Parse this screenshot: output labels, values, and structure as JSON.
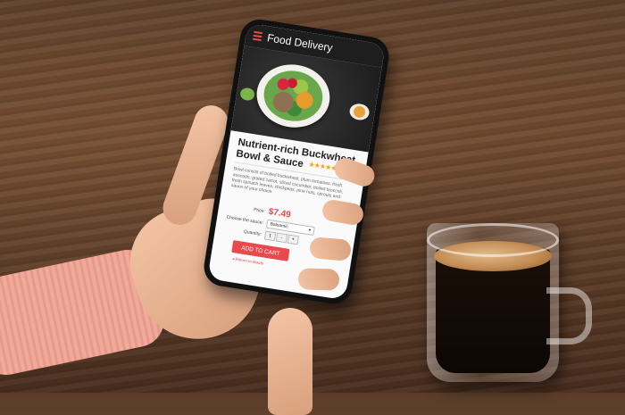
{
  "app": {
    "title": "Food Delivery"
  },
  "product": {
    "name": "Nutrient-rich Buckwheat Bowl & Sauce",
    "rating_stars": "★★★★★",
    "description": "Bowl consist of boiled buckwheat, plum tomatoes, fresh avocado, grated carrot, sliced cucumber, boiled broccoli, fresh spinach leaves, chickpeas, pine nuts, sprouts and sauce of your choice.",
    "price_label": "Price:",
    "price": "$7.49",
    "sauce_label": "Choose the sauce:",
    "sauce_selected": "Balsamic",
    "quantity_label": "Quantity:",
    "quantity_value": "1",
    "quantity_minus": "-",
    "quantity_plus": "+",
    "add_to_cart": "ADD TO CART",
    "return_link": "◂ Return to Bowls"
  },
  "colors": {
    "accent": "#e8494b",
    "header_bg": "#1e1e1e",
    "stars": "#f4a623"
  },
  "icons": {
    "menu": "hamburger-menu-icon",
    "dropdown": "chevron-down-icon"
  }
}
